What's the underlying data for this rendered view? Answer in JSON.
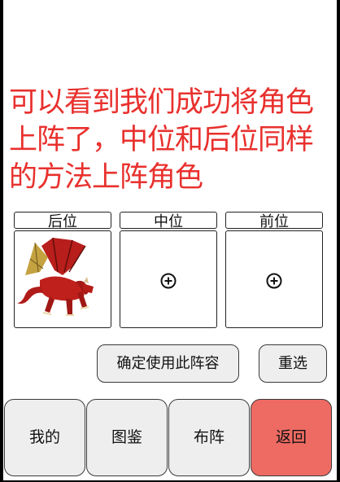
{
  "instruction": "可以看到我们成功将角色上阵了，中位和后位同样的方法上阵角色",
  "slots": [
    {
      "label": "后位",
      "content": "dragon"
    },
    {
      "label": "中位",
      "content": "empty"
    },
    {
      "label": "前位",
      "content": "empty"
    }
  ],
  "actions": {
    "confirm_label": "确定使用此阵容",
    "reselect_label": "重选"
  },
  "nav": {
    "items": [
      {
        "label": "我的"
      },
      {
        "label": "图鉴"
      },
      {
        "label": "布阵"
      },
      {
        "label": "返回"
      }
    ]
  },
  "colors": {
    "instruction_text": "#e8312e",
    "back_button": "#ee6b63",
    "button_bg": "#eeeeee",
    "dragon_red": "#c0201c"
  }
}
